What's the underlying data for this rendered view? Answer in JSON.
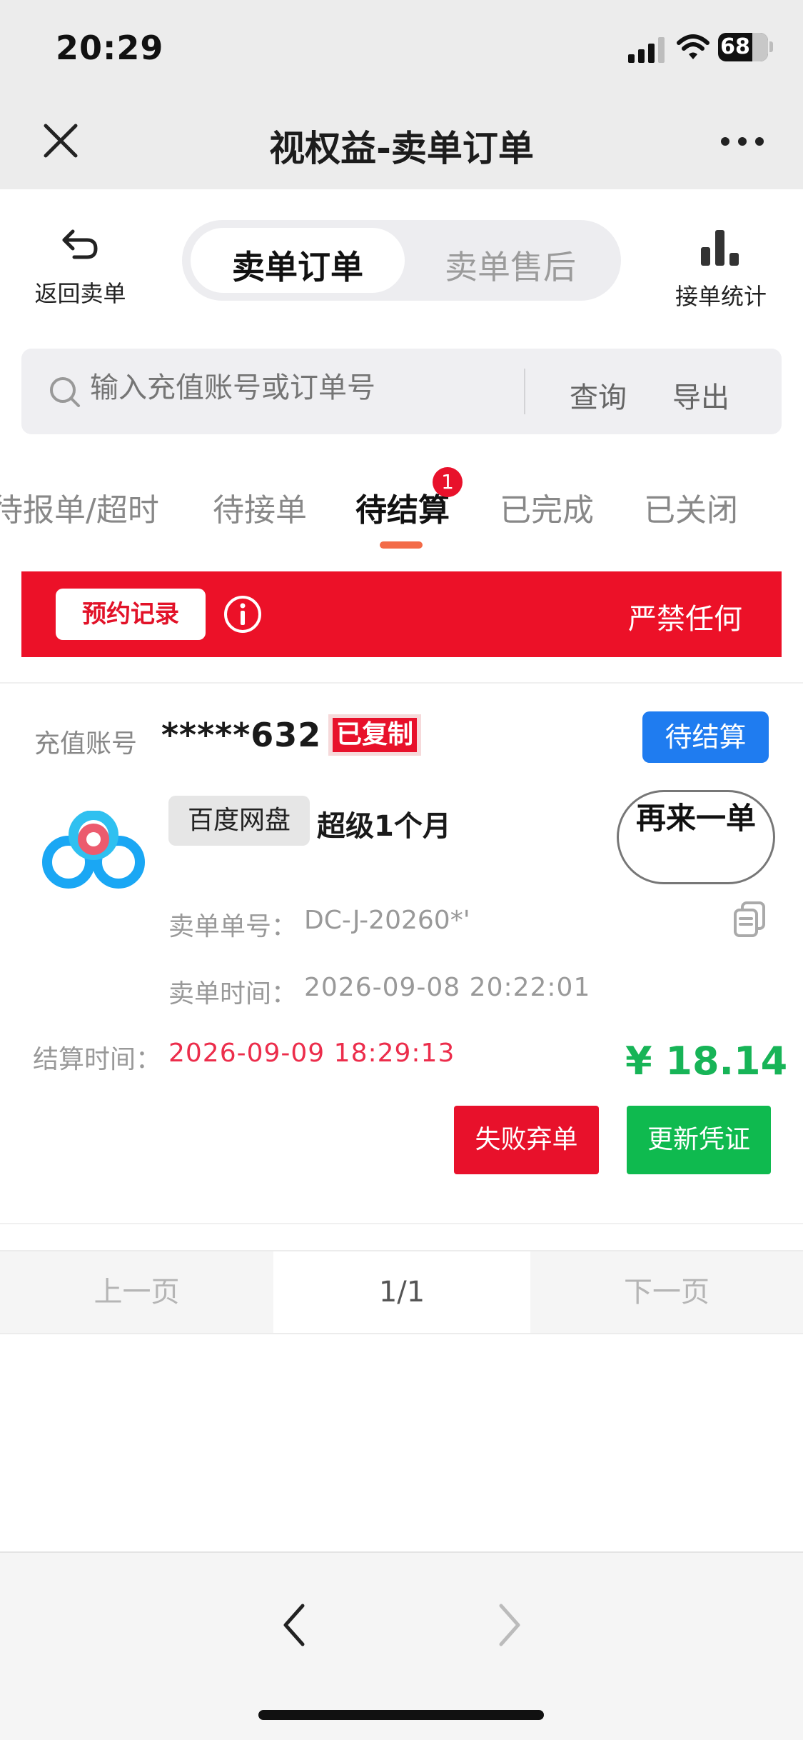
{
  "status_bar": {
    "time": "20:29",
    "battery": "68"
  },
  "nav": {
    "title": "视权益-卖单订单"
  },
  "top": {
    "back_label": "返回卖单",
    "segments": [
      "卖单订单",
      "卖单售后"
    ],
    "stats_label": "接单统计"
  },
  "search": {
    "placeholder": "输入充值账号或订单号",
    "query_label": "查询",
    "export_label": "导出"
  },
  "tabs": {
    "items": [
      "待报单/超时",
      "待接单",
      "待结算",
      "已完成",
      "已关闭"
    ],
    "active_index": 2,
    "badge": "1"
  },
  "banner": {
    "button_label": "预约记录",
    "notice_text": "严禁任何",
    "background": "#ec1128"
  },
  "order": {
    "account_label": "充值账号",
    "account_value": "*****632",
    "copied_label": "已复制",
    "status": "待结算",
    "platform": "百度网盘",
    "product": "超级1个月",
    "reorder_label": "再来一单",
    "order_no_label": "卖单单号：",
    "order_no_value": "DC-J-20260*'",
    "order_time_label": "卖单时间：",
    "order_time_value": "2026-09-08 20:22:01",
    "settle_label": "结算时间：",
    "settle_value": "2026-09-09 18:29:13",
    "price": "¥ 18.14",
    "fail_label": "失败弃单",
    "update_label": "更新凭证"
  },
  "pager": {
    "prev": "上一页",
    "page": "1/1",
    "next": "下一页"
  },
  "colors": {
    "accent_red": "#e8112b",
    "status_blue": "#1f7cf0",
    "price_green": "#17b457",
    "button_green": "#0fba4f"
  },
  "icons": [
    "close-icon",
    "more-icon",
    "back-arrow-icon",
    "bar-chart-icon",
    "search-icon",
    "info-icon",
    "copy-icon",
    "chevron-left-icon",
    "chevron-right-icon"
  ]
}
